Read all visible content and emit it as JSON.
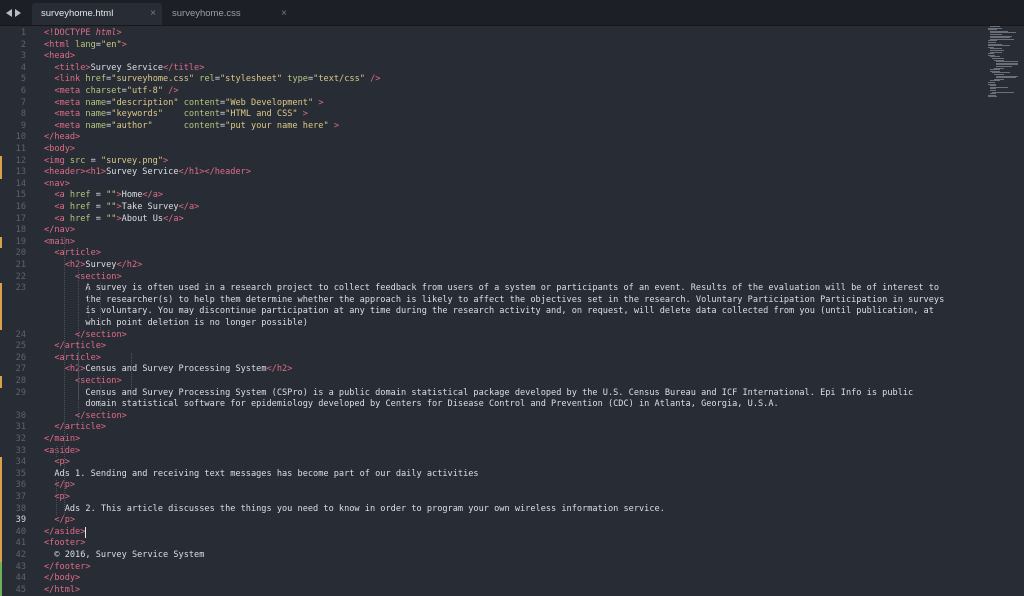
{
  "tabs": [
    {
      "label": "surveyhome.html",
      "active": true
    },
    {
      "label": "surveyhome.css",
      "active": false
    }
  ],
  "close_glyph": "×",
  "editor": {
    "current_line": 39,
    "line_numbers": [
      "1",
      "2",
      "3",
      "4",
      "5",
      "6",
      "7",
      "8",
      "9",
      "10",
      "11",
      "12",
      "13",
      "14",
      "15",
      "16",
      "17",
      "18",
      "19",
      "20",
      "21",
      "22",
      "23",
      "",
      "",
      "",
      "24",
      "25",
      "26",
      "27",
      "28",
      "29",
      "",
      "30",
      "31",
      "32",
      "33",
      "34",
      "35",
      "36",
      "37",
      "38",
      "39",
      "40",
      "41",
      "42",
      "43",
      "44",
      "45"
    ],
    "line_count": 45
  },
  "code_lines": [
    [
      [
        "t",
        "<!DOCTYPE "
      ],
      [
        "d",
        "html"
      ],
      [
        "t",
        ">"
      ]
    ],
    [
      [
        "t",
        "<html "
      ],
      [
        "a",
        "lang"
      ],
      [
        "c",
        "="
      ],
      [
        "s",
        "\"en\""
      ],
      [
        "t",
        ">"
      ]
    ],
    [
      [
        "t",
        "<head>"
      ]
    ],
    [
      [
        "c",
        "  "
      ],
      [
        "t",
        "<title>"
      ],
      [
        "c",
        "Survey Service"
      ],
      [
        "t",
        "</title>"
      ]
    ],
    [
      [
        "c",
        "  "
      ],
      [
        "t",
        "<link "
      ],
      [
        "a",
        "href"
      ],
      [
        "c",
        "="
      ],
      [
        "s",
        "\"surveyhome.css\""
      ],
      [
        "c",
        " "
      ],
      [
        "a",
        "rel"
      ],
      [
        "c",
        "="
      ],
      [
        "s",
        "\"stylesheet\""
      ],
      [
        "c",
        " "
      ],
      [
        "a",
        "type"
      ],
      [
        "c",
        "="
      ],
      [
        "s",
        "\"text/css\""
      ],
      [
        "c",
        " "
      ],
      [
        "t",
        "/>"
      ]
    ],
    [
      [
        "c",
        "  "
      ],
      [
        "t",
        "<meta "
      ],
      [
        "a",
        "charset"
      ],
      [
        "c",
        "="
      ],
      [
        "s",
        "\"utf-8\""
      ],
      [
        "c",
        " "
      ],
      [
        "t",
        "/>"
      ]
    ],
    [
      [
        "c",
        "  "
      ],
      [
        "t",
        "<meta "
      ],
      [
        "a",
        "name"
      ],
      [
        "c",
        "="
      ],
      [
        "s",
        "\"description\""
      ],
      [
        "c",
        " "
      ],
      [
        "a",
        "content"
      ],
      [
        "c",
        "="
      ],
      [
        "s",
        "\"Web Development\""
      ],
      [
        "c",
        " "
      ],
      [
        "t",
        ">"
      ]
    ],
    [
      [
        "c",
        "  "
      ],
      [
        "t",
        "<meta "
      ],
      [
        "a",
        "name"
      ],
      [
        "c",
        "="
      ],
      [
        "s",
        "\"keywords\""
      ],
      [
        "c",
        "    "
      ],
      [
        "a",
        "content"
      ],
      [
        "c",
        "="
      ],
      [
        "s",
        "\"HTML and CSS\""
      ],
      [
        "c",
        " "
      ],
      [
        "t",
        ">"
      ]
    ],
    [
      [
        "c",
        "  "
      ],
      [
        "t",
        "<meta "
      ],
      [
        "a",
        "name"
      ],
      [
        "c",
        "="
      ],
      [
        "s",
        "\"author\""
      ],
      [
        "c",
        "      "
      ],
      [
        "a",
        "content"
      ],
      [
        "c",
        "="
      ],
      [
        "s",
        "\"put your name here\""
      ],
      [
        "c",
        " "
      ],
      [
        "t",
        ">"
      ]
    ],
    [
      [
        "t",
        "</head>"
      ]
    ],
    [
      [
        "t",
        "<body>"
      ]
    ],
    [
      [
        "t",
        "<img "
      ],
      [
        "a",
        "src"
      ],
      [
        "c",
        " = "
      ],
      [
        "s",
        "\"survey.png\""
      ],
      [
        "t",
        ">"
      ]
    ],
    [
      [
        "t",
        "<header><h1>"
      ],
      [
        "c",
        "Survey Service"
      ],
      [
        "t",
        "</h1></header>"
      ]
    ],
    [
      [
        "t",
        "<nav>"
      ]
    ],
    [
      [
        "c",
        "  "
      ],
      [
        "t",
        "<a "
      ],
      [
        "a",
        "href"
      ],
      [
        "c",
        " = "
      ],
      [
        "s",
        "\"\""
      ],
      [
        "t",
        ">"
      ],
      [
        "c",
        "Home"
      ],
      [
        "t",
        "</a>"
      ]
    ],
    [
      [
        "c",
        "  "
      ],
      [
        "t",
        "<a "
      ],
      [
        "a",
        "href"
      ],
      [
        "c",
        " = "
      ],
      [
        "s",
        "\"\""
      ],
      [
        "t",
        ">"
      ],
      [
        "c",
        "Take Survey"
      ],
      [
        "t",
        "</a>"
      ]
    ],
    [
      [
        "c",
        "  "
      ],
      [
        "t",
        "<a "
      ],
      [
        "a",
        "href"
      ],
      [
        "c",
        " = "
      ],
      [
        "s",
        "\"\""
      ],
      [
        "t",
        ">"
      ],
      [
        "c",
        "About Us"
      ],
      [
        "t",
        "</a>"
      ]
    ],
    [
      [
        "t",
        "</nav>"
      ]
    ],
    [
      [
        "t",
        "<main>"
      ]
    ],
    [
      [
        "c",
        "  "
      ],
      [
        "t",
        "<article>"
      ]
    ],
    [
      [
        "c",
        "    "
      ],
      [
        "t",
        "<h2>"
      ],
      [
        "c",
        "Survey"
      ],
      [
        "t",
        "</h2>"
      ]
    ],
    [
      [
        "c",
        "      "
      ],
      [
        "t",
        "<section>"
      ]
    ],
    [
      [
        "c",
        "        A survey is often used in a research project to collect feedback from users of a system or participants of an event. Results of the evaluation will be of interest to"
      ]
    ],
    [
      [
        "c",
        "        the researcher(s) to help them determine whether the approach is likely to affect the objectives set in the research. Voluntary Participation Participation in surveys"
      ]
    ],
    [
      [
        "c",
        "        is voluntary. You may discontinue participation at any time during the research activity and, on request, will delete data collected from you (until publication, at"
      ]
    ],
    [
      [
        "c",
        "        which point deletion is no longer possible)"
      ]
    ],
    [
      [
        "c",
        "      "
      ],
      [
        "t",
        "</section>"
      ]
    ],
    [
      [
        "c",
        "  "
      ],
      [
        "t",
        "</article>"
      ]
    ],
    [
      [
        "c",
        "  "
      ],
      [
        "t",
        "<article>"
      ]
    ],
    [
      [
        "c",
        "    "
      ],
      [
        "t",
        "<h2>"
      ],
      [
        "c",
        "Census and Survey Processing System"
      ],
      [
        "t",
        "</h2>"
      ]
    ],
    [
      [
        "c",
        "      "
      ],
      [
        "t",
        "<section>"
      ]
    ],
    [
      [
        "c",
        "        Census and Survey Processing System (CSPro) is a public domain statistical package developed by the U.S. Census Bureau and ICF International. Epi Info is public"
      ]
    ],
    [
      [
        "c",
        "        domain statistical software for epidemiology developed by Centers for Disease Control and Prevention (CDC) in Atlanta, Georgia, U.S.A."
      ]
    ],
    [
      [
        "c",
        "      "
      ],
      [
        "t",
        "</section>"
      ]
    ],
    [
      [
        "c",
        "  "
      ],
      [
        "t",
        "</article>"
      ]
    ],
    [
      [
        "t",
        "</main>"
      ]
    ],
    [
      [
        "t",
        "<aside>"
      ]
    ],
    [
      [
        "c",
        "  "
      ],
      [
        "t",
        "<p>"
      ]
    ],
    [
      [
        "c",
        "  Ads 1. Sending and receiving text messages has become part of our daily activities"
      ]
    ],
    [
      [
        "c",
        "  "
      ],
      [
        "t",
        "</p>"
      ]
    ],
    [
      [
        "c",
        "  "
      ],
      [
        "t",
        "<p>"
      ]
    ],
    [
      [
        "c",
        "    Ads 2. This article discusses the things you need to know in order to program your own wireless information service."
      ]
    ],
    [
      [
        "c",
        "  "
      ],
      [
        "t",
        "</p>"
      ]
    ],
    [
      [
        "t",
        "</aside>"
      ]
    ],
    [
      [
        "t",
        "<footer>"
      ]
    ],
    [
      [
        "c",
        "  © 2016, Survey Service System"
      ]
    ],
    [
      [
        "t",
        "</footer>"
      ]
    ],
    [
      [
        "t",
        "</body>"
      ]
    ],
    [
      [
        "t",
        "</html>"
      ]
    ]
  ]
}
